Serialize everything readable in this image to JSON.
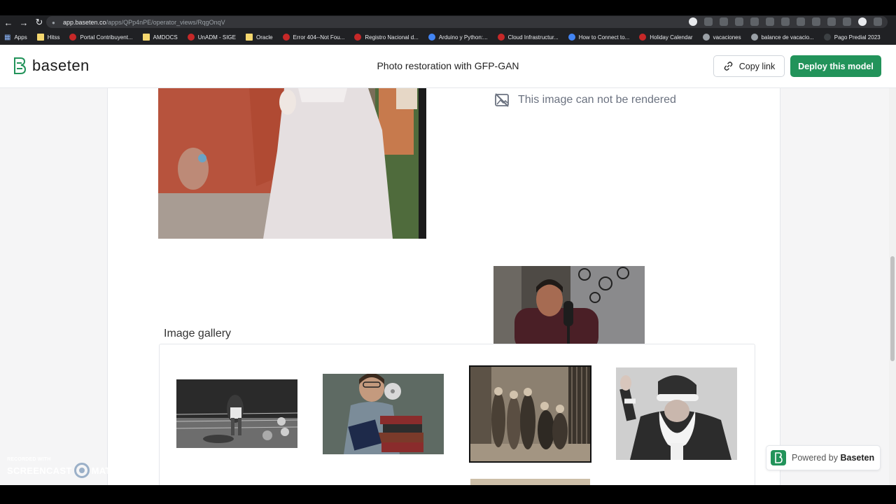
{
  "browser": {
    "url_host": "app.baseten.co",
    "url_path": "/apps/QPp4nPE/operator_views/RqgOnqV",
    "bookmarks": [
      {
        "label": "Apps",
        "icon": "apps-grid-icon"
      },
      {
        "label": "Hitss",
        "icon": "folder-icon"
      },
      {
        "label": "Portal Contribuyent...",
        "icon": "red-circle-icon"
      },
      {
        "label": "AMDOCS",
        "icon": "folder-icon"
      },
      {
        "label": "UnADM - SIGE",
        "icon": "red-circle-icon"
      },
      {
        "label": "Oracle",
        "icon": "folder-icon"
      },
      {
        "label": "Error 404--Not Fou...",
        "icon": "oracle-icon"
      },
      {
        "label": "Registro Nacional d...",
        "icon": "red-circle-icon"
      },
      {
        "label": "Arduino y Python:...",
        "icon": "blue-square-icon"
      },
      {
        "label": "Cloud Infrastructur...",
        "icon": "oracle-ring-icon"
      },
      {
        "label": "How to Connect to...",
        "icon": "x-icon"
      },
      {
        "label": "Holiday Calendar",
        "icon": "oracle-icon"
      },
      {
        "label": "vacaciones",
        "icon": "globe-icon"
      },
      {
        "label": "balance de vacacio...",
        "icon": "globe-icon"
      },
      {
        "label": "Pago Predial 2023",
        "icon": "dark-icon"
      }
    ]
  },
  "header": {
    "logo_text": "baseten",
    "title": "Photo restoration with GFP-GAN",
    "copy_link_label": "Copy link",
    "deploy_label": "Deploy this model"
  },
  "output": {
    "not_rendered_text": "This image can not be rendered"
  },
  "gallery": {
    "title": "Image gallery",
    "items": [
      {
        "name": "boxing-photo"
      },
      {
        "name": "man-with-books-photo"
      },
      {
        "name": "group-portrait-photo",
        "selected": true
      },
      {
        "name": "santa-claus-photo"
      }
    ]
  },
  "footer_badge": {
    "prefix": "Powered by",
    "brand": "Baseten"
  },
  "watermark": {
    "line1": "RECORDED WITH",
    "line2a": "SCREENCAST",
    "line2b": "MATIC"
  },
  "colors": {
    "accent": "#22935a",
    "chrome": "#202124"
  }
}
